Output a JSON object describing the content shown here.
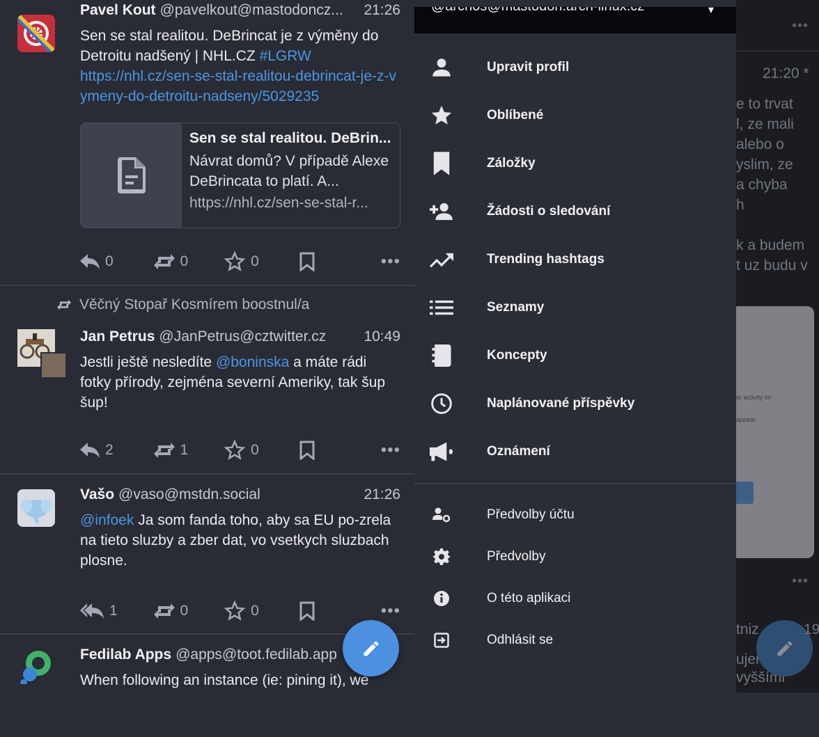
{
  "timeline": {
    "posts": [
      {
        "name": "Pavel Kout",
        "acct": "@pavelkout@mastodoncz...",
        "time": "21:26",
        "text": "Sen se stal realitou. DeBrincat je z výměny do Detroitu nadšený | NHL.CZ ",
        "hashtag": "#LGRW",
        "link": "https://nhl.cz/sen-se-stal-realitou-debrincat-je-z-vymeny-do-detroitu-nadseny/5029235",
        "card": {
          "title": "Sen se stal realitou. DeBrin...",
          "description": "Návrat domů? V případě Alexe DeBrincata to platí. A...",
          "url": "https://nhl.cz/sen-se-stal-r..."
        },
        "replies": "0",
        "boosts": "0",
        "favourites": "0"
      },
      {
        "boosted_by": "Věčný Stopař Kosmírem boostnul/a",
        "name": "Jan Petrus",
        "acct": "@JanPetrus@cztwitter.cz",
        "time": "10:49",
        "text_before": "Jestli ještě nesledíte ",
        "mention": "@boninska",
        "text_after": " a máte rádi fotky přírody, zejména severní Ameriky, tak šup šup!",
        "replies": "2",
        "boosts": "1",
        "favourites": "0"
      },
      {
        "name": "Vašo",
        "acct": "@vaso@mstdn.social",
        "time": "21:26",
        "mention": "@infoek",
        "text_after": " Ja som fanda toho, aby sa EU po-zrela na tieto sluzby a zber dat, vo vsetkych sluzbach plosne.",
        "replies": "1",
        "boosts": "0",
        "favourites": "0"
      },
      {
        "name": "Fedilab Apps",
        "acct": "@apps@toot.fedilab.app",
        "text": "When following an instance (ie: pining it), we"
      }
    ],
    "more_label": "•••"
  },
  "drawer": {
    "account": "@archos@mastodon.arch-linux.cz",
    "menu": [
      {
        "label": "Upravit profil",
        "icon": "person-icon"
      },
      {
        "label": "Oblíbené",
        "icon": "star-icon"
      },
      {
        "label": "Záložky",
        "icon": "bookmark-icon"
      },
      {
        "label": "Žádosti o sledování",
        "icon": "person-add-icon"
      },
      {
        "label": "Trending hashtags",
        "icon": "trending-icon"
      },
      {
        "label": "Seznamy",
        "icon": "list-icon"
      },
      {
        "label": "Koncepty",
        "icon": "drafts-icon"
      },
      {
        "label": "Naplánované příspěvky",
        "icon": "clock-icon"
      },
      {
        "label": "Oznámení",
        "icon": "megaphone-icon"
      }
    ],
    "secondary": [
      {
        "label": "Předvolby účtu",
        "icon": "account-settings-icon"
      },
      {
        "label": "Předvolby",
        "icon": "gear-icon"
      },
      {
        "label": "O této aplikaci",
        "icon": "info-icon"
      },
      {
        "label": "Odhlásit se",
        "icon": "logout-icon"
      }
    ]
  },
  "background_panel": {
    "time": "21:20 *",
    "lines": [
      "e to trvat",
      "l, ze mali",
      "alebo o",
      "yslim, ze",
      "a chyba",
      "h",
      "",
      "k a budem",
      "t uz budu v"
    ],
    "card_text_1": "or activity on",
    "card_text_2": "appeal.",
    "lower_1": "tniz",
    "lower_1b": "19",
    "lower_2": "ujer",
    "lower_3": "vyššími"
  }
}
